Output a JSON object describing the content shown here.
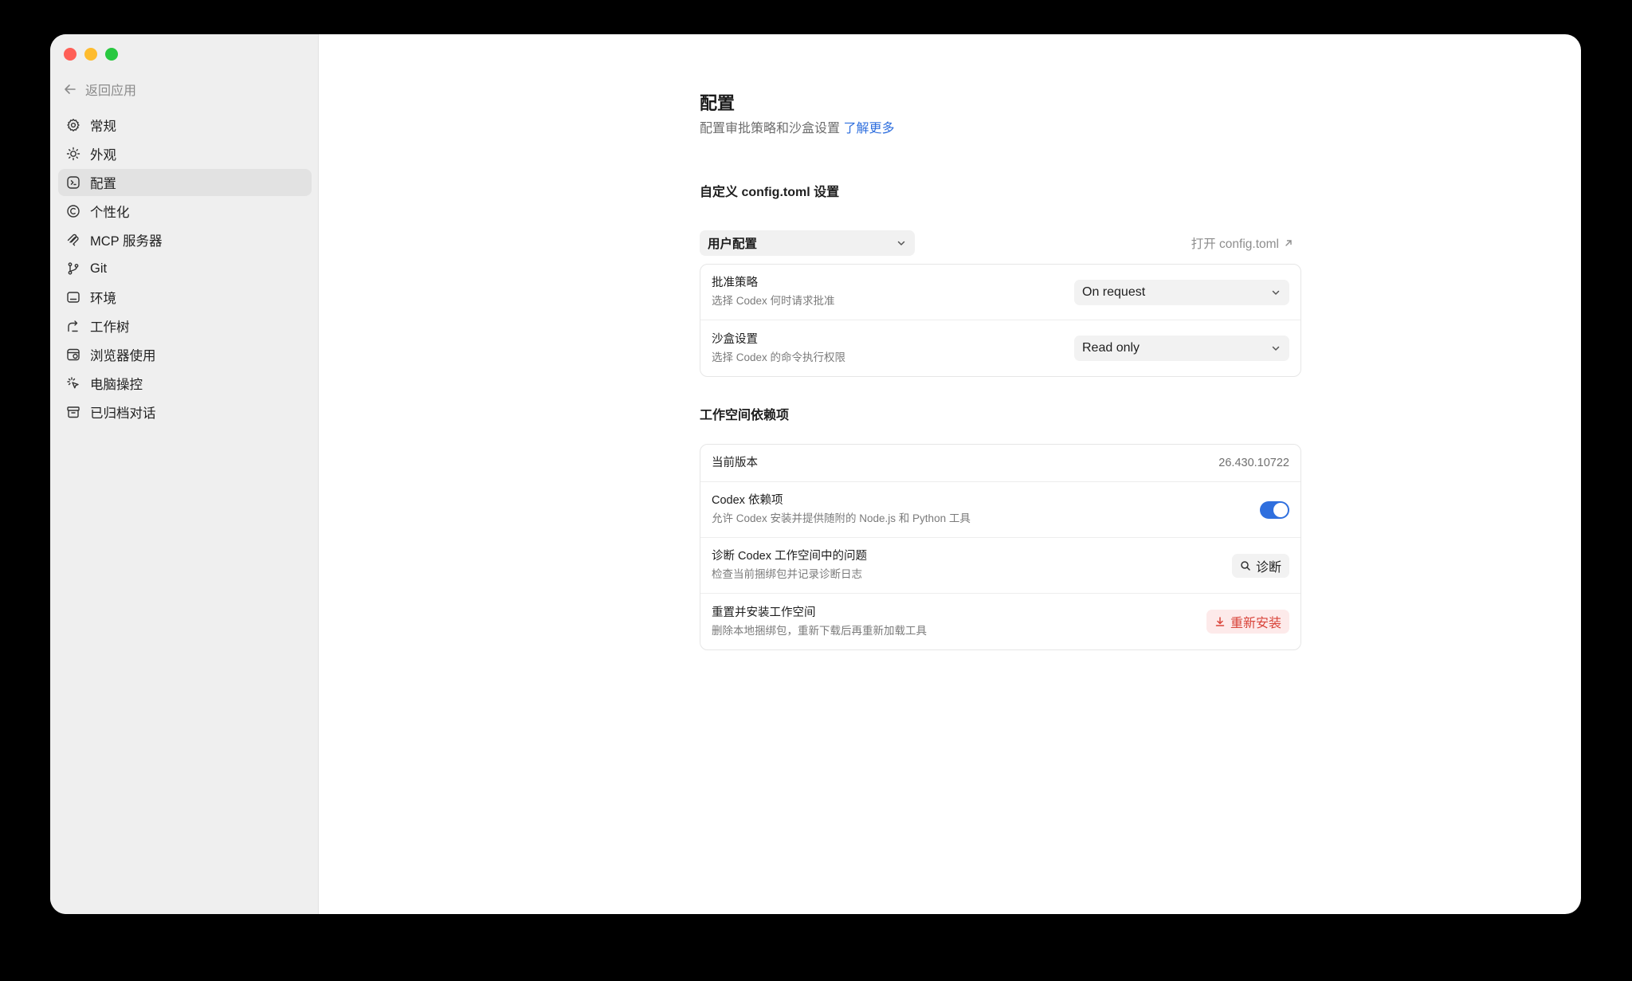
{
  "sidebar": {
    "back_label": "返回应用",
    "items": [
      {
        "label": "常规",
        "icon": "gear-icon"
      },
      {
        "label": "外观",
        "icon": "sun-icon"
      },
      {
        "label": "配置",
        "icon": "code-badge-icon",
        "active": true
      },
      {
        "label": "个性化",
        "icon": "personalize-icon"
      },
      {
        "label": "MCP 服务器",
        "icon": "mcp-icon"
      },
      {
        "label": "Git",
        "icon": "git-branch-icon"
      },
      {
        "label": "环境",
        "icon": "terminal-icon"
      },
      {
        "label": "工作树",
        "icon": "worktree-icon"
      },
      {
        "label": "浏览器使用",
        "icon": "browser-icon"
      },
      {
        "label": "电脑操控",
        "icon": "cursor-click-icon"
      },
      {
        "label": "已归档对话",
        "icon": "archive-icon"
      }
    ]
  },
  "header": {
    "title": "配置",
    "subtitle": "配置审批策略和沙盒设置",
    "learn_more": "了解更多"
  },
  "custom_config": {
    "section_title": "自定义 config.toml 设置",
    "profile_select": "用户配置",
    "open_link": "打开 config.toml",
    "rows": [
      {
        "label": "批准策略",
        "desc": "选择 Codex 何时请求批准",
        "value": "On request"
      },
      {
        "label": "沙盒设置",
        "desc": "选择 Codex 的命令执行权限",
        "value": "Read only"
      }
    ]
  },
  "workspace": {
    "section_title": "工作空间依赖项",
    "version_label": "当前版本",
    "version_value": "26.430.10722",
    "deps_label": "Codex 依赖项",
    "deps_desc": "允许 Codex 安装并提供随附的 Node.js 和 Python 工具",
    "deps_enabled": true,
    "diagnose_label": "诊断 Codex 工作空间中的问题",
    "diagnose_desc": "检查当前捆绑包并记录诊断日志",
    "diagnose_button": "诊断",
    "reset_label": "重置并安装工作空间",
    "reset_desc": "删除本地捆绑包，重新下载后再重新加载工具",
    "reinstall_button": "重新安装"
  },
  "colors": {
    "accent": "#2f6fde",
    "danger": "#d9443a",
    "sidebar_bg": "#efefef",
    "traffic_close": "#ff5f57",
    "traffic_min": "#febc2e",
    "traffic_max": "#28c840"
  }
}
